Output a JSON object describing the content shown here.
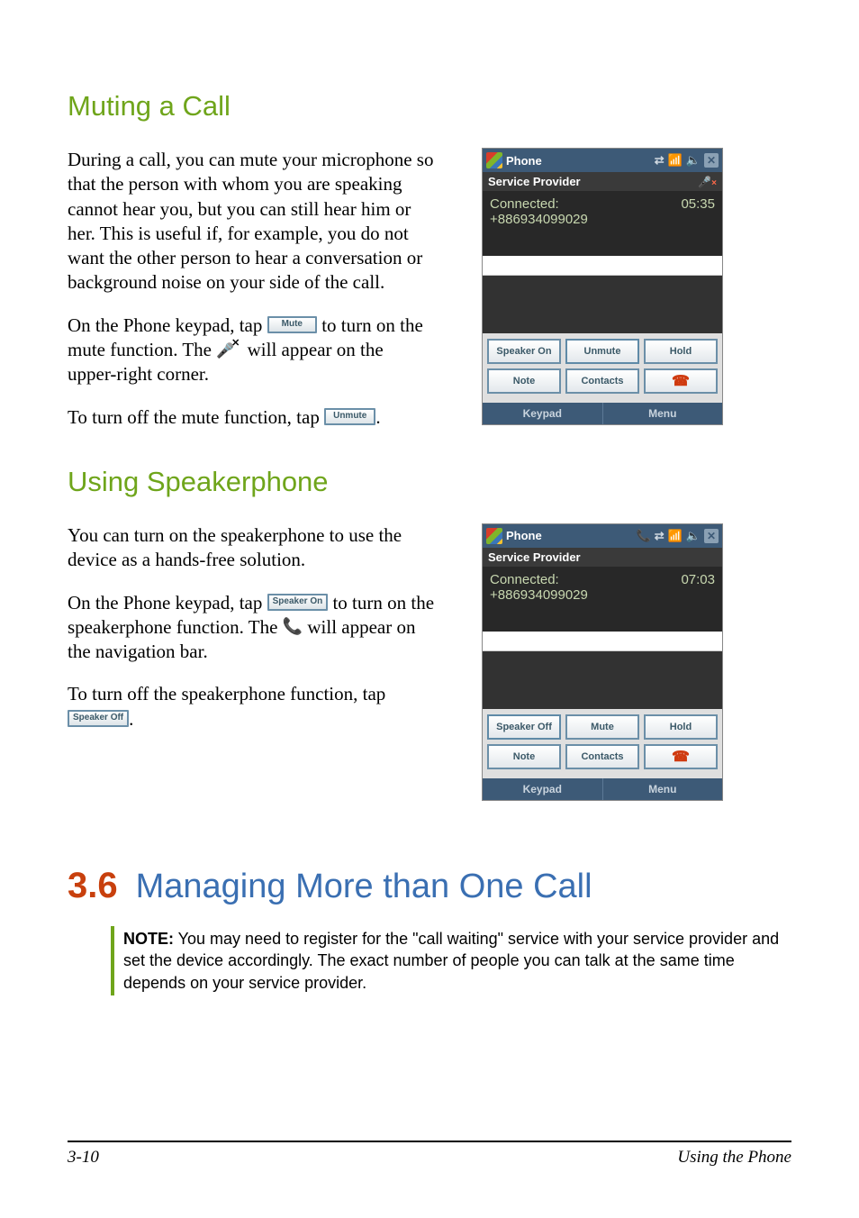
{
  "headings": {
    "muting": "Muting a Call",
    "speakerphone": "Using Speakerphone"
  },
  "muting": {
    "p1": "During a call, you can mute your microphone so that the person with whom you are speaking cannot hear you, but you can still hear him or her. This is useful if, for example, you do not want the other person to hear a conversation or background noise on your side of the call.",
    "p2a": "On the Phone keypad, tap ",
    "p2b": " to turn on the mute function. The ",
    "p2c": " will appear on the upper-right corner.",
    "p3a": "To turn off the mute function, tap ",
    "p3b": "."
  },
  "speaker": {
    "p1": "You can turn on the speakerphone to use the device as a hands-free solution.",
    "p2a": "On the Phone keypad, tap ",
    "p2b": " to turn on the speakerphone function. The ",
    "p2c": " will appear on the navigation bar.",
    "p3a": "To turn off the speakerphone function, tap ",
    "p3b": "."
  },
  "inline_buttons": {
    "mute": "Mute",
    "unmute": "Unmute",
    "speaker_on": "Speaker On",
    "speaker_off": "Speaker Off"
  },
  "icons": {
    "mute_glyph": "🎤✕",
    "speaker_glyph": "📞"
  },
  "mock1": {
    "title": "Phone",
    "provider": "Service Provider",
    "connected": "Connected:",
    "number": "+886934099029",
    "time": "05:35",
    "btns": {
      "r1c1": "Speaker On",
      "r1c2": "Unmute",
      "r1c3": "Hold",
      "r2c1": "Note",
      "r2c2": "Contacts"
    },
    "bottom_left": "Keypad",
    "bottom_right": "Menu",
    "mute_badge": "🎤×"
  },
  "mock2": {
    "title": "Phone",
    "provider": "Service Provider",
    "connected": "Connected:",
    "number": "+886934099029",
    "time": "07:03",
    "btns": {
      "r1c1": "Speaker Off",
      "r1c2": "Mute",
      "r1c3": "Hold",
      "r2c1": "Note",
      "r2c2": "Contacts"
    },
    "bottom_left": "Keypad",
    "bottom_right": "Menu"
  },
  "chapter": {
    "num": "3.6",
    "title": "Managing More than One Call"
  },
  "note": {
    "label": "NOTE:",
    "text": " You may need to register for the \"call waiting\" service with your service provider and set the device accordingly. The exact number of people you can talk at the same time depends on your service provider."
  },
  "footer": {
    "left": "3-10",
    "right": "Using the Phone"
  }
}
